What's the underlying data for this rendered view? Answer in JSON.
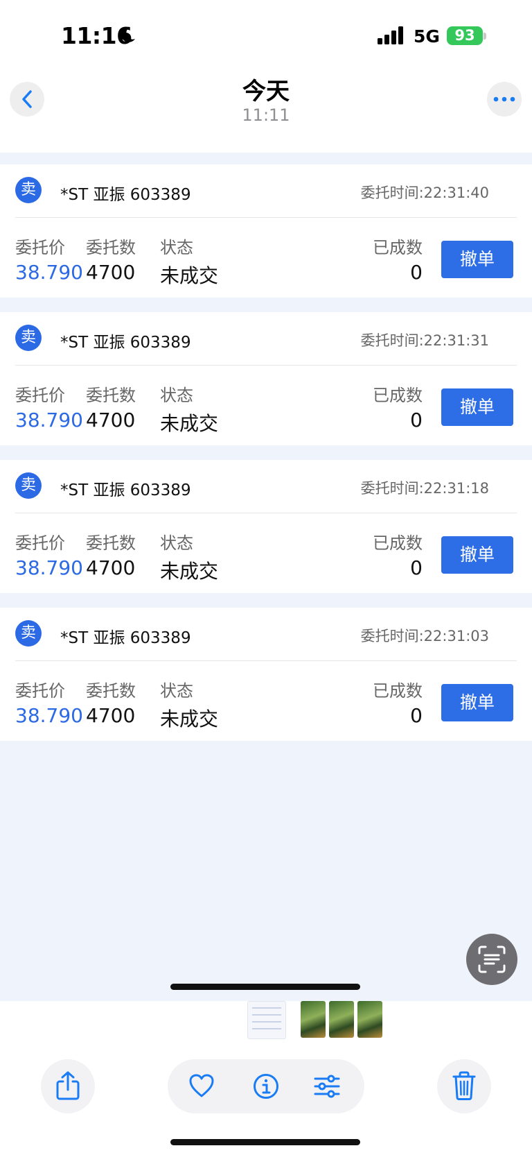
{
  "status_bar": {
    "time": "11:16",
    "network": "5G",
    "battery": "93"
  },
  "header": {
    "title": "今天",
    "subtitle": "11:11"
  },
  "orders": [
    {
      "side": "卖",
      "stock": "*ST 亚振 603389",
      "time": "委托时间:22:31:40",
      "price_label": "委托价",
      "price": "38.790",
      "qty_label": "委托数",
      "qty": "4700",
      "status_label": "状态",
      "status": "未成交",
      "filled_label": "已成数",
      "filled": "0",
      "cancel_label": "撤单"
    },
    {
      "side": "卖",
      "stock": "*ST 亚振 603389",
      "time": "委托时间:22:31:31",
      "price_label": "委托价",
      "price": "38.790",
      "qty_label": "委托数",
      "qty": "4700",
      "status_label": "状态",
      "status": "未成交",
      "filled_label": "已成数",
      "filled": "0",
      "cancel_label": "撤单"
    },
    {
      "side": "卖",
      "stock": "*ST 亚振 603389",
      "time": "委托时间:22:31:18",
      "price_label": "委托价",
      "price": "38.790",
      "qty_label": "委托数",
      "qty": "4700",
      "status_label": "状态",
      "status": "未成交",
      "filled_label": "已成数",
      "filled": "0",
      "cancel_label": "撤单"
    },
    {
      "side": "卖",
      "stock": "*ST 亚振 603389",
      "time": "委托时间:22:31:03",
      "price_label": "委托价",
      "price": "38.790",
      "qty_label": "委托数",
      "qty": "4700",
      "status_label": "状态",
      "status": "未成交",
      "filled_label": "已成数",
      "filled": "0",
      "cancel_label": "撤单"
    }
  ],
  "icons": {
    "back": "chevron-left-icon",
    "more": "ellipsis-icon",
    "scan": "live-text-scan-icon",
    "share": "share-icon",
    "favorite": "heart-icon",
    "info": "info-icon",
    "adjust": "sliders-icon",
    "delete": "trash-icon"
  },
  "colors": {
    "accent": "#2b6ae4",
    "ios_blue": "#1a7cf5",
    "battery_green": "#34c759",
    "content_bg": "#eff3fb"
  }
}
